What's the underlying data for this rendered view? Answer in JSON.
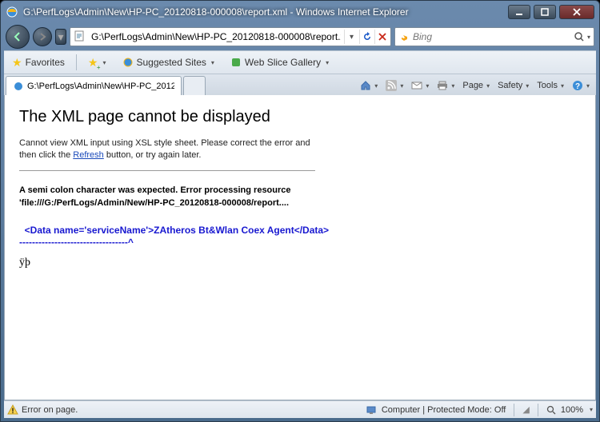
{
  "titlebar": {
    "text": "G:\\PerfLogs\\Admin\\New\\HP-PC_20120818-000008\\report.xml - Windows Internet Explorer"
  },
  "nav": {
    "address": "G:\\PerfLogs\\Admin\\New\\HP-PC_20120818-000008\\report.xml",
    "search_placeholder": "Bing"
  },
  "favbar": {
    "favorites": "Favorites",
    "suggested": "Suggested Sites",
    "webslice": "Web Slice Gallery"
  },
  "tabs": {
    "active": "G:\\PerfLogs\\Admin\\New\\HP-PC_20120818-0000..."
  },
  "cmdbar": {
    "page": "Page",
    "safety": "Safety",
    "tools": "Tools"
  },
  "page": {
    "heading": "The XML page cannot be displayed",
    "msg_before": "Cannot view XML input using XSL style sheet. Please correct the error and then click the ",
    "msg_link": "Refresh",
    "msg_after": " button, or try again later.",
    "error": "A semi colon character was expected. Error processing resource 'file:///G:/PerfLogs/Admin/New/HP-PC_20120818-000008/report....",
    "code_line1": "  <Data name='serviceName'>ZAtheros Bt&Wlan Coex Agent</Data>",
    "code_line2": "----------------------------------^",
    "junk": "ÿþ"
  },
  "status": {
    "left": "Error on page.",
    "zone": "Computer | Protected Mode: Off",
    "zoom": "100%"
  }
}
